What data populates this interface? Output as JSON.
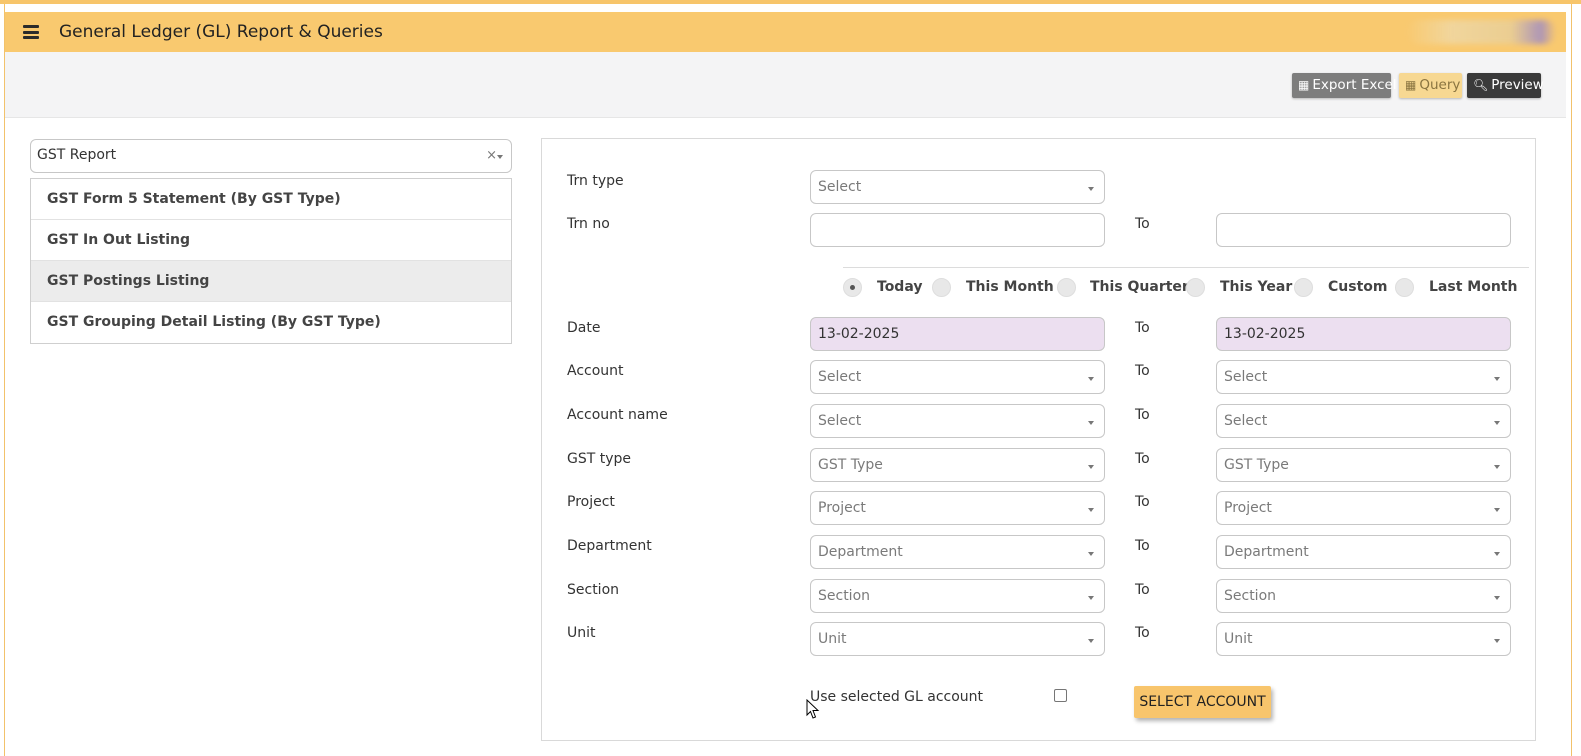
{
  "app": {
    "title": "General Ledger (GL) Report & Queries",
    "accent_color": "#f9c96f"
  },
  "toolbar": {
    "export_excel_label": "Export Excel",
    "query_label": "Query",
    "preview_label": "Preview"
  },
  "report_selector": {
    "value": "GST Report",
    "items": [
      {
        "label": "GST Form 5 Statement (By GST Type)",
        "active": false
      },
      {
        "label": "GST In Out Listing",
        "active": false
      },
      {
        "label": "GST Postings Listing",
        "active": true
      },
      {
        "label": "GST Grouping Detail Listing (By GST Type)",
        "active": false
      }
    ]
  },
  "form": {
    "trn_type": {
      "label": "Trn type",
      "placeholder": "Select"
    },
    "trn_no": {
      "label": "Trn no",
      "to_label": "To",
      "from_value": "",
      "to_value": ""
    },
    "date_ranges": [
      {
        "label": "Today",
        "checked": true
      },
      {
        "label": "This Month",
        "checked": false
      },
      {
        "label": "This Quarter",
        "checked": false
      },
      {
        "label": "This Year",
        "checked": false
      },
      {
        "label": "Custom",
        "checked": false
      },
      {
        "label": "Last Month",
        "checked": false
      }
    ],
    "date": {
      "label": "Date",
      "to_label": "To",
      "from_value": "13-02-2025",
      "to_value": "13-02-2025"
    },
    "account": {
      "label": "Account",
      "to_label": "To",
      "from_placeholder": "Select",
      "to_placeholder": "Select"
    },
    "account_name": {
      "label": "Account name",
      "to_label": "To",
      "from_placeholder": "Select",
      "to_placeholder": "Select"
    },
    "gst_type": {
      "label": "GST type",
      "to_label": "To",
      "from_placeholder": "GST Type",
      "to_placeholder": "GST Type"
    },
    "project": {
      "label": "Project",
      "to_label": "To",
      "from_placeholder": "Project",
      "to_placeholder": "Project"
    },
    "department": {
      "label": "Department",
      "to_label": "To",
      "from_placeholder": "Department",
      "to_placeholder": "Department"
    },
    "section": {
      "label": "Section",
      "to_label": "To",
      "from_placeholder": "Section",
      "to_placeholder": "Section"
    },
    "unit": {
      "label": "Unit",
      "to_label": "To",
      "from_placeholder": "Unit",
      "to_placeholder": "Unit"
    },
    "use_selected_gl": {
      "label": "Use selected GL account",
      "checked": false
    },
    "select_account_label": "SELECT ACCOUNT"
  }
}
